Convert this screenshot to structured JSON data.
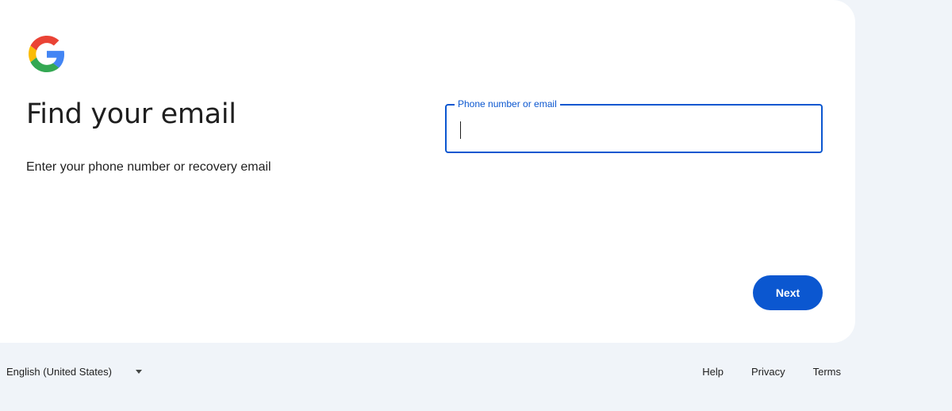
{
  "brand": {
    "logo_icon": "google-g-logo",
    "colors": {
      "blue": "#4285F4",
      "red": "#EA4335",
      "yellow": "#FBBC05",
      "green": "#34A853",
      "accent": "#0b57d0"
    }
  },
  "main": {
    "title": "Find your email",
    "subtitle": "Enter your phone number or recovery email"
  },
  "form": {
    "field_label": "Phone number or email",
    "field_value": ""
  },
  "actions": {
    "next_label": "Next"
  },
  "footer": {
    "language": "English (United States)",
    "language_icon": "chevron-down-icon",
    "links": [
      "Help",
      "Privacy",
      "Terms"
    ]
  }
}
